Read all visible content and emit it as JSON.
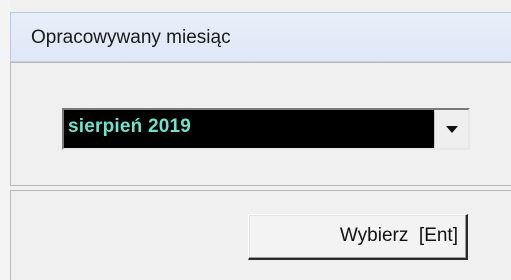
{
  "window": {
    "title": "Opracowywany miesiąc"
  },
  "month_select": {
    "value": "sierpień 2019"
  },
  "select_button": {
    "label": "Wybierz  [Ent]"
  }
}
